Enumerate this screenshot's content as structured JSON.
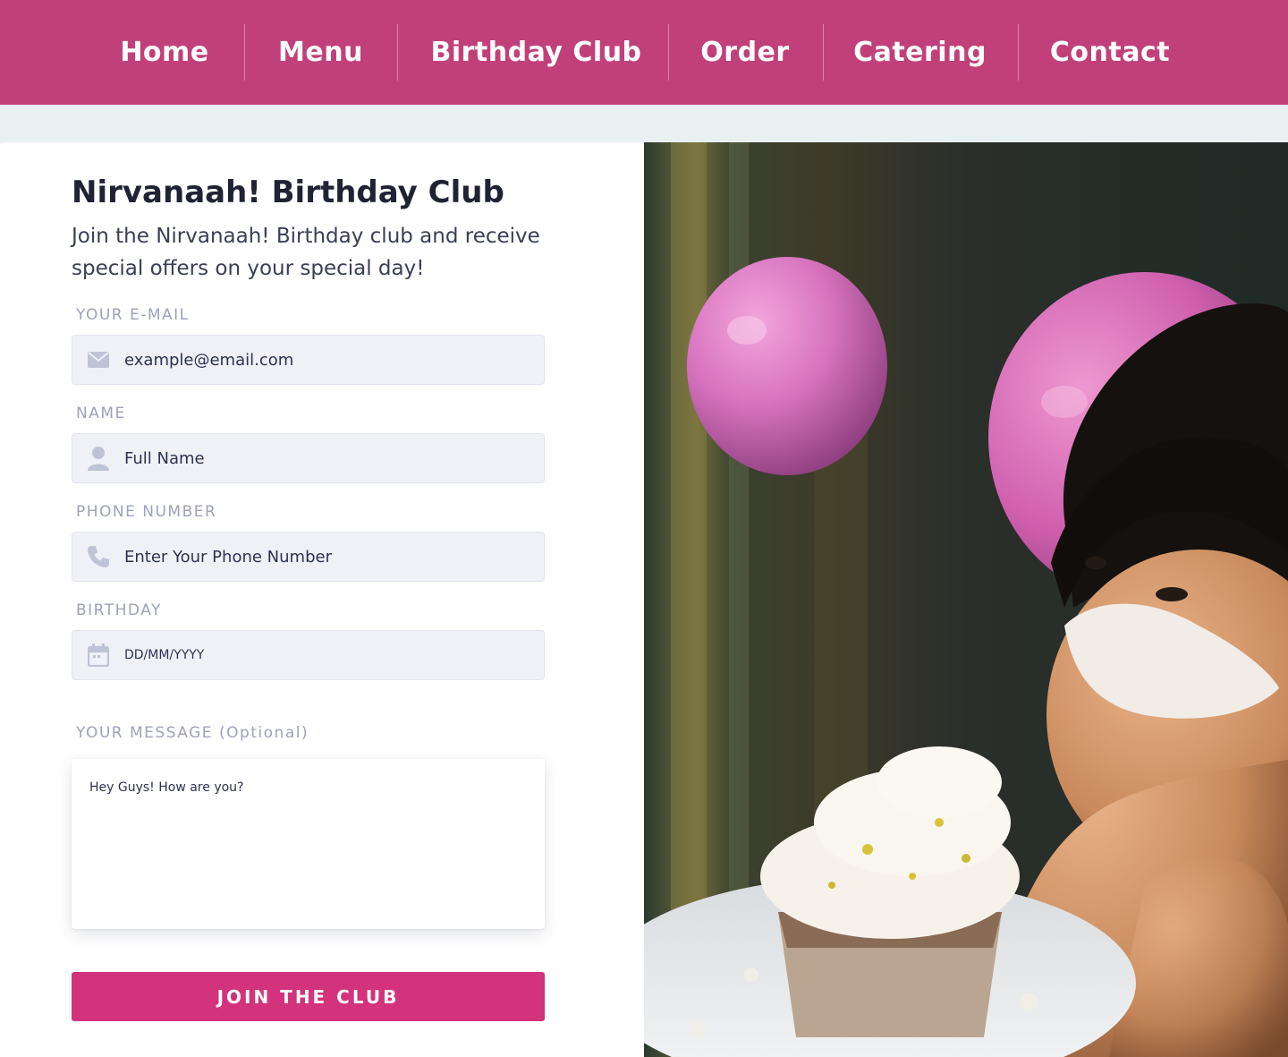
{
  "nav": {
    "items": [
      {
        "label": "Home"
      },
      {
        "label": "Menu"
      },
      {
        "label": "Birthday Club"
      },
      {
        "label": "Order"
      },
      {
        "label": "Catering"
      },
      {
        "label": "Contact"
      }
    ]
  },
  "form": {
    "title": "Nirvanaah! Birthday Club",
    "subtitle": "Join the Nirvanaah! Birthday club and receive special offers on your special day!",
    "email": {
      "label": "YOUR E-MAIL",
      "placeholder": "example@email.com",
      "icon": "envelope-icon"
    },
    "name": {
      "label": "NAME",
      "placeholder": "Full Name",
      "icon": "user-icon"
    },
    "phone": {
      "label": "PHONE NUMBER",
      "placeholder": "Enter Your Phone Number",
      "icon": "phone-icon"
    },
    "birthday": {
      "label": "BIRTHDAY",
      "placeholder": "DD/MM/YYYY",
      "icon": "calendar-icon"
    },
    "message": {
      "label": "YOUR MESSAGE (Optional)",
      "value": "Hey Guys! How are you?"
    },
    "submit_label": "JOIN THE CLUB"
  },
  "colors": {
    "nav_bg": "#c2407a",
    "button_bg": "#d3327d",
    "page_bg": "#e8f0f2",
    "field_bg": "#f0f1f7",
    "label_color": "#9ea2b8",
    "heading_color": "#1f2333"
  }
}
